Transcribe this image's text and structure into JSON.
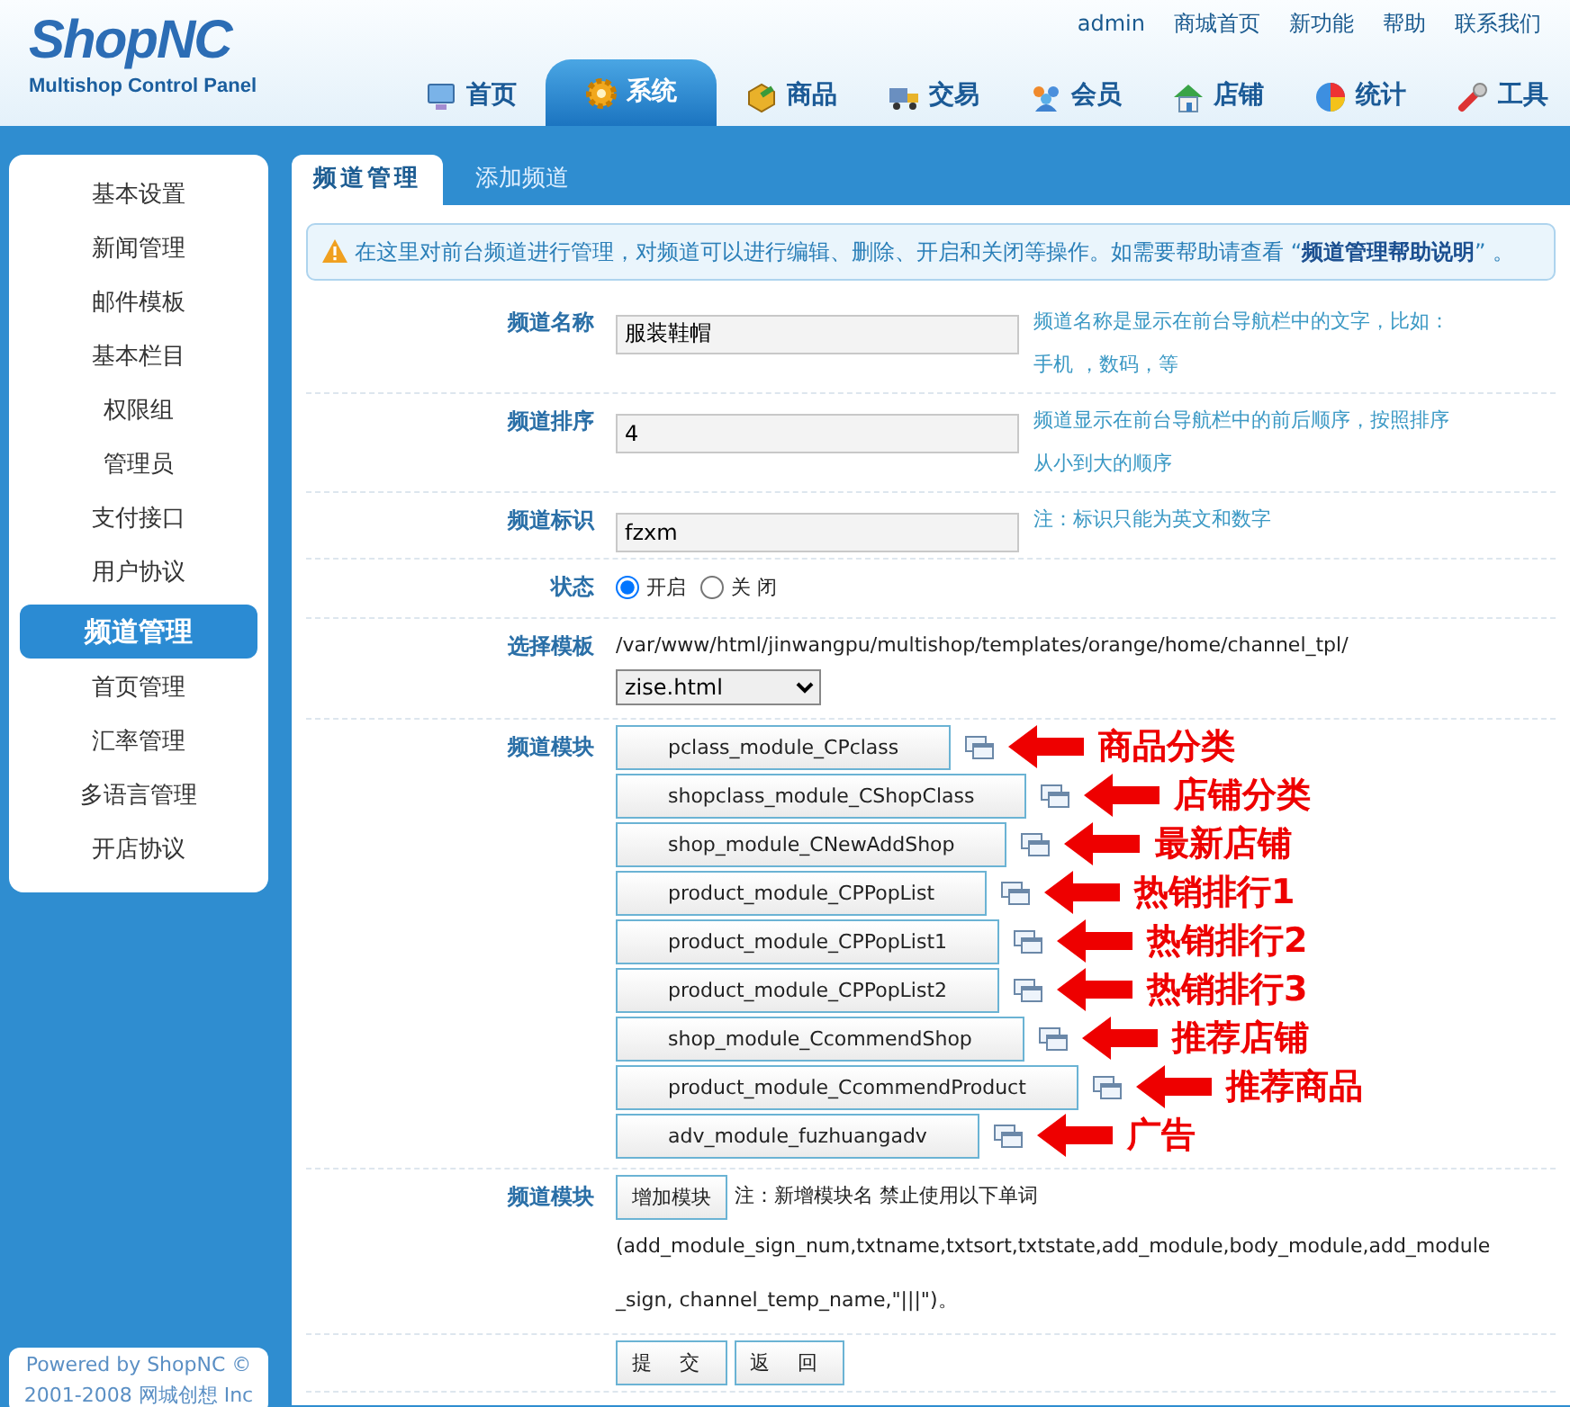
{
  "header": {
    "brand": "ShopNC",
    "subtitle": "Multishop Control Panel",
    "top_links": [
      "admin",
      "商城首页",
      "新功能",
      "帮助",
      "联系我们"
    ],
    "nav": [
      {
        "label": "首页",
        "selected": false,
        "kind": "monitor"
      },
      {
        "label": "系统",
        "selected": true,
        "kind": "gear"
      },
      {
        "label": "商品",
        "selected": false,
        "kind": "box"
      },
      {
        "label": "交易",
        "selected": false,
        "kind": "truck"
      },
      {
        "label": "会员",
        "selected": false,
        "kind": "people"
      },
      {
        "label": "店铺",
        "selected": false,
        "kind": "house"
      },
      {
        "label": "统计",
        "selected": false,
        "kind": "pie"
      },
      {
        "label": "工具",
        "selected": false,
        "kind": "wrench"
      }
    ]
  },
  "sidebar": {
    "items": [
      {
        "label": "基本设置",
        "selected": false
      },
      {
        "label": "新闻管理",
        "selected": false
      },
      {
        "label": "邮件模板",
        "selected": false
      },
      {
        "label": "基本栏目",
        "selected": false
      },
      {
        "label": "权限组",
        "selected": false
      },
      {
        "label": "管理员",
        "selected": false
      },
      {
        "label": "支付接口",
        "selected": false
      },
      {
        "label": "用户协议",
        "selected": false
      },
      {
        "label": "频道管理",
        "selected": true
      },
      {
        "label": "首页管理",
        "selected": false
      },
      {
        "label": "汇率管理",
        "selected": false
      },
      {
        "label": "多语言管理",
        "selected": false
      },
      {
        "label": "开店协议",
        "selected": false
      }
    ],
    "footer": [
      "Powered by ShopNC ©",
      "2001-2008 网城创想  Inc"
    ]
  },
  "tabs": [
    {
      "label": "频道管理",
      "selected": true
    },
    {
      "label": "添加频道",
      "selected": false
    }
  ],
  "notice": "在这里对前台频道进行管理，对频道可以进行编辑、删除、开启和关闭等操作。如需要帮助请查看 “**频道管理帮助说明**” 。",
  "form": {
    "fields": [
      {
        "label": "频道名称",
        "value": "服装鞋帽",
        "help": [
          "频道名称是显示在前台导航栏中的文字，比如：",
          "手机  ，数码，等"
        ]
      },
      {
        "label": "频道排序",
        "value": "4",
        "help": [
          "频道显示在前台导航栏中的前后顺序，按照排序",
          "从小到大的顺序"
        ]
      },
      {
        "label": "频道标识",
        "value": "fzxm",
        "help": [
          "注：标识只能为英文和数字"
        ]
      }
    ],
    "state": {
      "label": "状态",
      "options": [
        {
          "label": "开启",
          "selected": true
        },
        {
          "label": "关 闭",
          "selected": false
        }
      ]
    },
    "template": {
      "label": "选择模板",
      "path": "/var/www/html/jinwangpu/multishop/templates/orange/home/channel_tpl/",
      "value": "zise.html"
    },
    "modules": {
      "label": "频道模块",
      "items": [
        {
          "name": "pclass_module_CPclass",
          "annotation": "商品分类"
        },
        {
          "name": "shopclass_module_CShopClass",
          "annotation": "店铺分类"
        },
        {
          "name": "shop_module_CNewAddShop",
          "annotation": "最新店铺"
        },
        {
          "name": "product_module_CPPopList",
          "annotation": "热销排行1"
        },
        {
          "name": "product_module_CPPopList1",
          "annotation": "热销排行2"
        },
        {
          "name": "product_module_CPPopList2",
          "annotation": "热销排行3"
        },
        {
          "name": "shop_module_CcommendShop",
          "annotation": "推荐店铺"
        },
        {
          "name": "product_module_CcommendProduct",
          "annotation": "推荐商品"
        },
        {
          "name": "adv_module_fuzhuangadv",
          "annotation": "广告"
        }
      ]
    },
    "add_module": {
      "label": "频道模块",
      "button": "增加模块",
      "note": "注：新增模块名 禁止使用以下单词",
      "words": "(add_module_sign_num,txtname,txtsort,txtstate,add_module,body_module,add_module_sign, channel_temp_name,\"|||\")。"
    },
    "buttons": [
      "提 交",
      "返 回"
    ]
  }
}
